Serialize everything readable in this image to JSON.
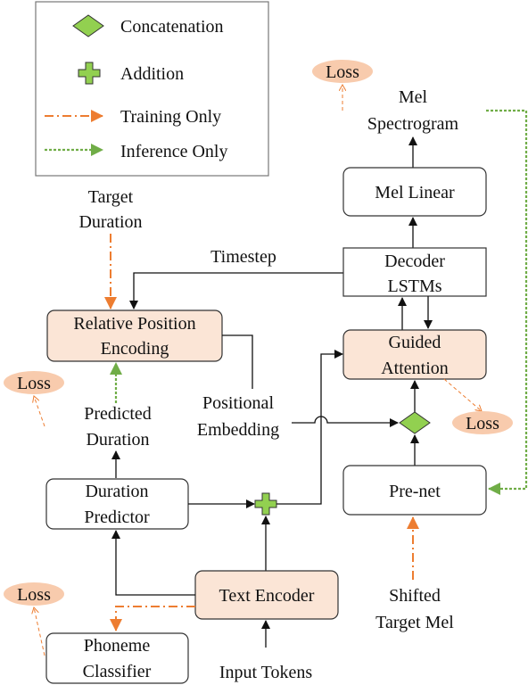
{
  "legend": {
    "concatenation": "Concatenation",
    "addition": "Addition",
    "training_only": "Training Only",
    "inference_only": "Inference Only"
  },
  "colors": {
    "peach": "#fbe5d6",
    "green": "#92d050",
    "orange": "#ed7d31",
    "dotted_green": "#70ad47",
    "loss": "#f8cbad"
  },
  "labels": {
    "target_duration": [
      "Target",
      "Duration"
    ],
    "timestep": "Timestep",
    "predicted_duration": [
      "Predicted",
      "Duration"
    ],
    "positional_embedding": [
      "Positional",
      "Embedding"
    ],
    "input_tokens": "Input Tokens",
    "shifted_target_mel": [
      "Shifted",
      "Target Mel"
    ],
    "mel_spectrogram": [
      "Mel",
      "Spectrogram"
    ],
    "loss": "Loss"
  },
  "blocks": {
    "relative_position_encoding": [
      "Relative Position",
      "Encoding"
    ],
    "duration_predictor": [
      "Duration",
      "Predictor"
    ],
    "text_encoder": "Text Encoder",
    "phoneme_classifier": [
      "Phoneme",
      "Classifier"
    ],
    "mel_linear": "Mel Linear",
    "decoder_lstms": [
      "Decoder",
      "LSTMs"
    ],
    "guided_attention": [
      "Guided",
      "Attention"
    ],
    "pre_net": "Pre-net"
  }
}
